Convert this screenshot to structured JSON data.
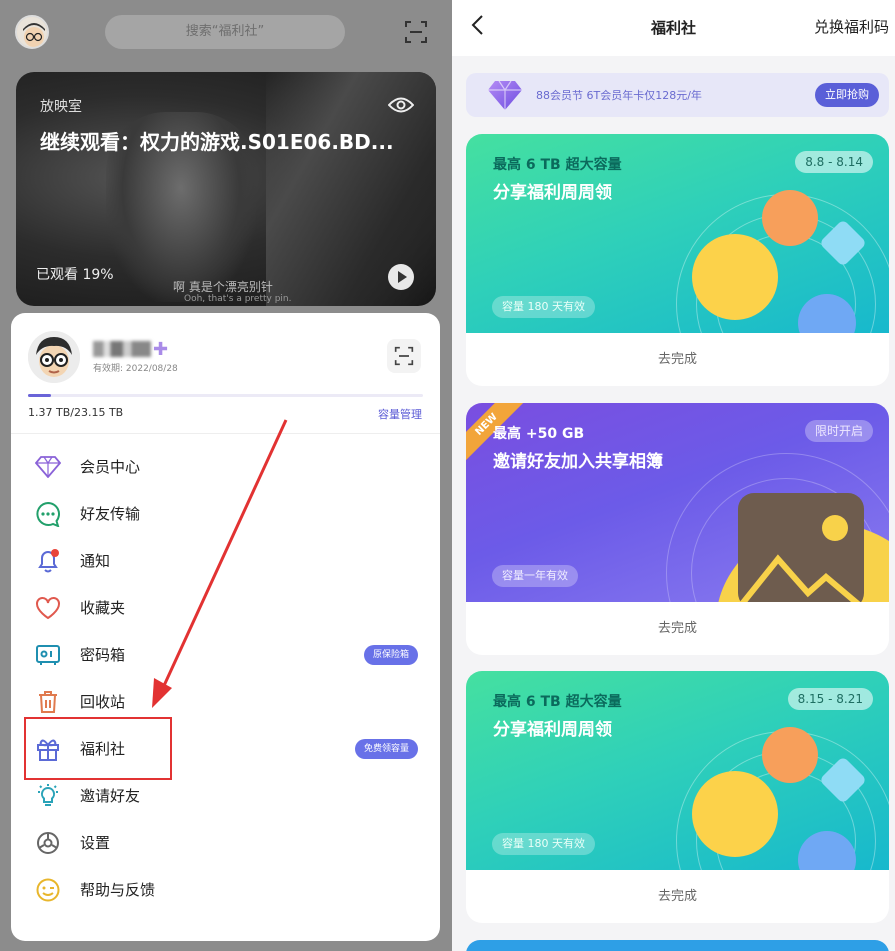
{
  "left": {
    "search_placeholder": "搜索“福利社”",
    "banner": {
      "label": "放映室",
      "title": "继续观看：权力的游戏.S01E06.BD...",
      "progress": "已观看 19%",
      "progress_value": 0.19,
      "subtitle_cn": "啊 真是个漂亮别针",
      "subtitle_en": "Ooh, that's a pretty pin."
    },
    "account": {
      "expiry": "有效期: 2022/08/28",
      "storage_used": "1.37 TB/23.15 TB",
      "storage_fraction": 0.059,
      "manage_label": "容量管理"
    },
    "menu": [
      {
        "label": "会员中心",
        "icon": "diamond-icon"
      },
      {
        "label": "好友传输",
        "icon": "chat-icon"
      },
      {
        "label": "通知",
        "icon": "bell-icon"
      },
      {
        "label": "收藏夹",
        "icon": "heart-icon"
      },
      {
        "label": "密码箱",
        "icon": "safe-icon",
        "tag": "原保险箱"
      },
      {
        "label": "回收站",
        "icon": "trash-icon"
      },
      {
        "label": "福利社",
        "icon": "gift-icon",
        "tag": "免费领容量"
      },
      {
        "label": "邀请好友",
        "icon": "bulb-icon"
      },
      {
        "label": "设置",
        "icon": "settings-icon"
      },
      {
        "label": "帮助与反馈",
        "icon": "smile-icon"
      }
    ],
    "colors": {
      "highlight_box": "#e23232",
      "arrow": "#e23232",
      "accent": "#6871e8"
    }
  },
  "right": {
    "title": "福利社",
    "redeem_label": "兑换福利码",
    "promo": {
      "text": "88会员节 6T会员年卡仅128元/年",
      "button": "立即抢购"
    },
    "cards": [
      {
        "caption": "最高 6 TB 超大容量",
        "heading": "分享福利周周领",
        "date": "8.8 - 8.14",
        "valid": "容量 180 天有效",
        "action": "去完成",
        "theme": "green"
      },
      {
        "caption": "最高 +50 GB",
        "heading": "邀请好友加入共享相簿",
        "date": "限时开启",
        "valid": "容量一年有效",
        "action": "去完成",
        "theme": "purple",
        "badge": "NEW"
      },
      {
        "caption": "最高 6 TB 超大容量",
        "heading": "分享福利周周领",
        "date": "8.15 - 8.21",
        "valid": "容量 180 天有效",
        "action": "去完成",
        "theme": "green"
      }
    ]
  }
}
